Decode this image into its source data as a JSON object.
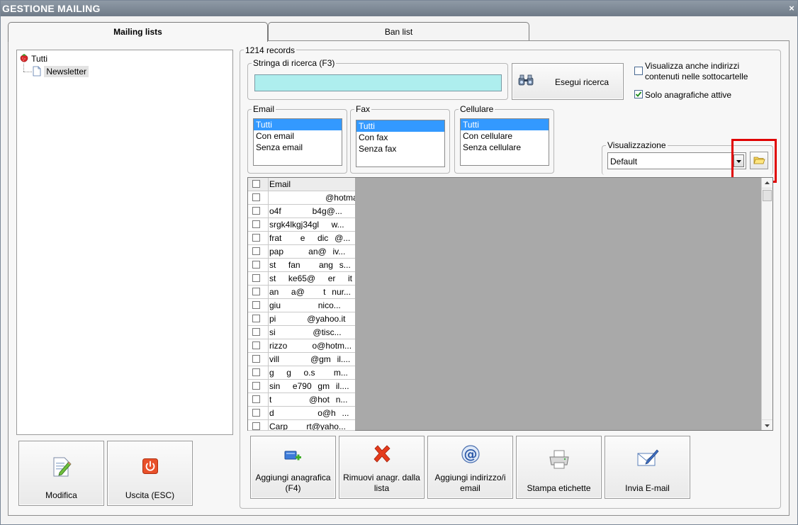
{
  "window": {
    "title": "GESTIONE MAILING",
    "close_glyph": "×"
  },
  "tabs": [
    {
      "label": "Mailing lists",
      "active": true
    },
    {
      "label": "Ban list",
      "active": false
    }
  ],
  "tree": {
    "root": "Tutti",
    "child": "Newsletter"
  },
  "left_buttons": {
    "modifica": "Modifica",
    "uscita": "Uscita (ESC)"
  },
  "records_label": "1214 records",
  "search": {
    "group_label": "Stringa di ricerca (F3)",
    "value": "",
    "button_label": "Esegui ricerca"
  },
  "options": {
    "subfolders_label": "Visualizza anche indirizzi contenuti nelle sottocartelle",
    "subfolders_checked": false,
    "active_only_label": "Solo anagrafiche attive",
    "active_only_checked": true
  },
  "filters": {
    "email": {
      "label": "Email",
      "items": [
        "Tutti",
        "Con email",
        "Senza email"
      ],
      "selected": "Tutti"
    },
    "fax": {
      "label": "Fax",
      "items": [
        "Tutti",
        "Con fax",
        "Senza fax"
      ],
      "selected": "Tutti"
    },
    "cellulare": {
      "label": "Cellulare",
      "items": [
        "Tutti",
        "Con cellulare",
        "Senza cellulare"
      ],
      "selected": "Tutti"
    }
  },
  "view": {
    "label": "Visualizzazione",
    "selected": "Default"
  },
  "grid": {
    "header": "Email",
    "rows": [
      "⠀⠀⠀⠀⠀⠀⠀⠀⠀@hotmail.c...",
      "o4f⠀⠀⠀⠀⠀b4g@...",
      "srgk4lkgj34gl⠀⠀w...",
      "frat⠀⠀⠀e⠀⠀dic⠀@...",
      "pap⠀⠀⠀⠀an@⠀iv...",
      "st⠀⠀fan⠀⠀⠀ang⠀s...",
      "st⠀⠀ke65@⠀⠀er⠀⠀it",
      "an⠀⠀a@⠀⠀⠀t⠀nur...",
      "giu⠀⠀⠀⠀⠀⠀nico...",
      "pi⠀⠀⠀⠀⠀@yahoo.it",
      "si⠀⠀⠀⠀⠀⠀@tisc...",
      "rizzo⠀⠀⠀⠀o@hotm...",
      "vill⠀⠀⠀⠀⠀@gm⠀il....",
      "g⠀⠀g⠀⠀o.s⠀⠀⠀m...",
      "sin⠀⠀e790⠀gm⠀il....",
      "t⠀⠀⠀⠀⠀⠀@hot⠀n...",
      "d⠀⠀⠀⠀⠀⠀⠀o@h⠀...",
      "Carp⠀⠀⠀rt@yaho..."
    ]
  },
  "actions": [
    {
      "label": "Aggiungi anagrafica (F4)",
      "icon": "add-contact-icon"
    },
    {
      "label": "Rimuovi anagr. dalla lista",
      "icon": "remove-x-icon"
    },
    {
      "label": "Aggiungi indirizzo/i email",
      "icon": "at-sign-icon"
    },
    {
      "label": "Stampa etichette",
      "icon": "printer-icon"
    },
    {
      "label": "Invia E-mail",
      "icon": "send-mail-icon"
    }
  ],
  "colors": {
    "search_field": "#aeeeee",
    "selection": "#3399ff",
    "highlight_box": "#e00000",
    "remove_icon": "#e53b1c"
  }
}
